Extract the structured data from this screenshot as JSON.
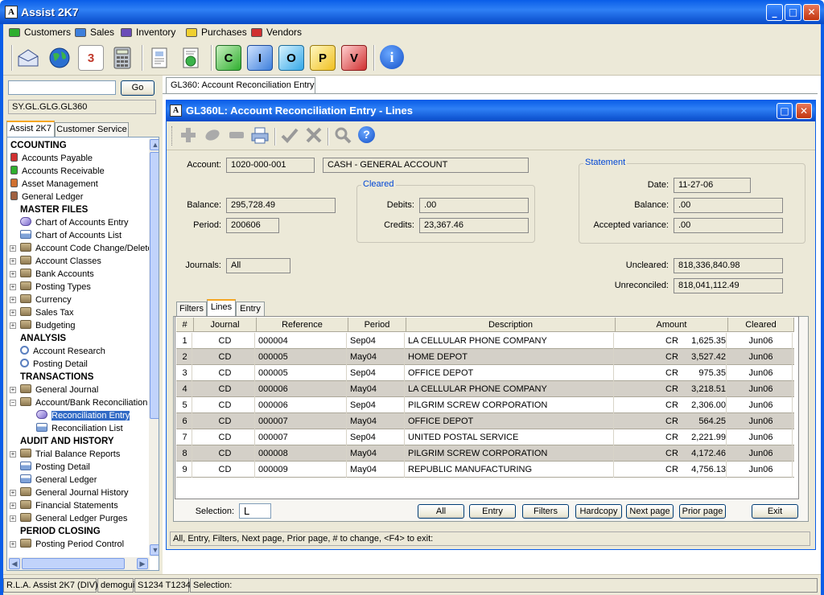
{
  "window": {
    "title": "Assist 2K7",
    "logo_text": "A",
    "minimize": "_",
    "maximize": "□",
    "close": "✕"
  },
  "menu": [
    {
      "label": "Customers",
      "color": "#2eae2e"
    },
    {
      "label": "Sales",
      "color": "#3d7fdc"
    },
    {
      "label": "Inventory",
      "color": "#6a4cb8"
    },
    {
      "label": "Purchases",
      "color": "#f0d030"
    },
    {
      "label": "Vendors",
      "color": "#d03030"
    }
  ],
  "toolbar": {
    "icons": [
      "mail-icon",
      "globe-icon",
      "calendar-icon",
      "calculator-icon",
      "document-icon",
      "chart-icon",
      "customers-c-icon",
      "inventory-i-icon",
      "orders-o-icon",
      "purchases-p-icon",
      "vendors-v-icon",
      "info-icon"
    ],
    "letters": {
      "calendar": "3",
      "c": "C",
      "i": "I",
      "o": "O",
      "p": "P",
      "v": "V",
      "info": "i"
    }
  },
  "left": {
    "search_value": "",
    "go_label": "Go",
    "path": "SY.GL.GLG.GL360",
    "tabs": [
      "Assist 2K7",
      "Customer Service"
    ],
    "tree": [
      {
        "label": "CCOUNTING",
        "type": "header",
        "indent": 0
      },
      {
        "label": "Accounts Payable",
        "type": "book",
        "color": "#d03030",
        "indent": 0
      },
      {
        "label": "Accounts Receivable",
        "type": "book",
        "color": "#2eae2e",
        "indent": 0
      },
      {
        "label": "Asset Management",
        "type": "book",
        "color": "#d07030",
        "indent": 0
      },
      {
        "label": "General Ledger",
        "type": "book",
        "color": "#a06040",
        "indent": 0
      },
      {
        "label": "MASTER FILES",
        "type": "header",
        "indent": 1
      },
      {
        "label": "Chart of Accounts Entry",
        "type": "pen",
        "indent": 1
      },
      {
        "label": "Chart of Accounts List",
        "type": "print",
        "indent": 1
      },
      {
        "label": "Account Code Change/Delete",
        "type": "folder",
        "indent": 1
      },
      {
        "label": "Account Classes",
        "type": "folder",
        "indent": 1
      },
      {
        "label": "Bank Accounts",
        "type": "folder",
        "indent": 1
      },
      {
        "label": "Posting Types",
        "type": "folder",
        "indent": 1
      },
      {
        "label": "Currency",
        "type": "folder",
        "indent": 1
      },
      {
        "label": "Sales Tax",
        "type": "folder",
        "indent": 1
      },
      {
        "label": "Budgeting",
        "type": "folder",
        "indent": 1
      },
      {
        "label": "ANALYSIS",
        "type": "header",
        "indent": 1
      },
      {
        "label": "Account Research",
        "type": "search",
        "indent": 1
      },
      {
        "label": "Posting Detail",
        "type": "search",
        "indent": 1
      },
      {
        "label": "TRANSACTIONS",
        "type": "header",
        "indent": 1
      },
      {
        "label": "General Journal",
        "type": "folder",
        "indent": 1
      },
      {
        "label": "Account/Bank Reconciliation",
        "type": "folder",
        "indent": 1
      },
      {
        "label": "Reconciliation Entry",
        "type": "pen",
        "indent": 2,
        "selected": true
      },
      {
        "label": "Reconciliation List",
        "type": "print",
        "indent": 2
      },
      {
        "label": "AUDIT AND HISTORY",
        "type": "header",
        "indent": 1
      },
      {
        "label": "Trial Balance Reports",
        "type": "folder",
        "indent": 1
      },
      {
        "label": "Posting Detail",
        "type": "print",
        "indent": 1
      },
      {
        "label": "General Ledger",
        "type": "print",
        "indent": 1
      },
      {
        "label": "General Journal History",
        "type": "folder",
        "indent": 1
      },
      {
        "label": "Financial Statements",
        "type": "folder",
        "indent": 1
      },
      {
        "label": "General Ledger Purges",
        "type": "folder",
        "indent": 1
      },
      {
        "label": "PERIOD CLOSING",
        "type": "header",
        "indent": 1
      },
      {
        "label": "Posting Period Control",
        "type": "folder",
        "indent": 1
      }
    ]
  },
  "mdi_tab": "GL360: Account Reconciliation Entry",
  "child": {
    "title": "GL360L: Account Reconciliation Entry - Lines",
    "logo_text": "A",
    "toolbar_icons": [
      "add-icon",
      "edit-icon",
      "delete-icon",
      "print-icon",
      "accept-check-icon",
      "cancel-x-icon",
      "find-icon",
      "help-icon"
    ],
    "fields": {
      "account_label": "Account:",
      "account": "1020-000-001",
      "account_name": "CASH - GENERAL ACCOUNT",
      "balance_label": "Balance:",
      "balance": "295,728.49",
      "period_label": "Period:",
      "period": "200606",
      "journals_label": "Journals:",
      "journals": "All",
      "cleared_group": "Cleared",
      "debits_label": "Debits:",
      "debits": ".00",
      "credits_label": "Credits:",
      "credits": "23,367.46",
      "statement_group": "Statement",
      "date_label": "Date:",
      "date": "11-27-06",
      "stmt_balance_label": "Balance:",
      "stmt_balance": ".00",
      "variance_label": "Accepted variance:",
      "variance": ".00",
      "uncleared_label": "Uncleared:",
      "uncleared": "818,336,840.98",
      "unreconciled_label": "Unreconciled:",
      "unreconciled": "818,041,112.49"
    },
    "subtabs": [
      "Filters",
      "Lines",
      "Entry"
    ],
    "active_subtab": "Lines",
    "table": {
      "columns": [
        "#",
        "Journal",
        "Reference",
        "Period",
        "Description",
        "Amount",
        "Cleared"
      ],
      "rows": [
        {
          "n": "1",
          "journal": "CD",
          "ref": "000004",
          "period": "Sep04",
          "desc": "LA CELLULAR PHONE COMPANY",
          "type": "CR",
          "amount": "1,625.35",
          "cleared": "Jun06"
        },
        {
          "n": "2",
          "journal": "CD",
          "ref": "000005",
          "period": "May04",
          "desc": "HOME DEPOT",
          "type": "CR",
          "amount": "3,527.42",
          "cleared": "Jun06"
        },
        {
          "n": "3",
          "journal": "CD",
          "ref": "000005",
          "period": "Sep04",
          "desc": "OFFICE DEPOT",
          "type": "CR",
          "amount": "975.35",
          "cleared": "Jun06"
        },
        {
          "n": "4",
          "journal": "CD",
          "ref": "000006",
          "period": "May04",
          "desc": "LA CELLULAR PHONE COMPANY",
          "type": "CR",
          "amount": "3,218.51",
          "cleared": "Jun06"
        },
        {
          "n": "5",
          "journal": "CD",
          "ref": "000006",
          "period": "Sep04",
          "desc": "PILGRIM SCREW CORPORATION",
          "type": "CR",
          "amount": "2,306.00",
          "cleared": "Jun06"
        },
        {
          "n": "6",
          "journal": "CD",
          "ref": "000007",
          "period": "May04",
          "desc": "OFFICE DEPOT",
          "type": "CR",
          "amount": "564.25",
          "cleared": "Jun06"
        },
        {
          "n": "7",
          "journal": "CD",
          "ref": "000007",
          "period": "Sep04",
          "desc": "UNITED POSTAL SERVICE",
          "type": "CR",
          "amount": "2,221.99",
          "cleared": "Jun06"
        },
        {
          "n": "8",
          "journal": "CD",
          "ref": "000008",
          "period": "May04",
          "desc": "PILGRIM SCREW CORPORATION",
          "type": "CR",
          "amount": "4,172.46",
          "cleared": "Jun06"
        },
        {
          "n": "9",
          "journal": "CD",
          "ref": "000009",
          "period": "May04",
          "desc": "REPUBLIC MANUFACTURING",
          "type": "CR",
          "amount": "4,756.13",
          "cleared": "Jun06"
        }
      ]
    },
    "selection_label": "Selection:",
    "selection_value": "L",
    "buttons": [
      "All",
      "Entry",
      "Filters",
      "Hardcopy",
      "Next page",
      "Prior page",
      "Exit"
    ],
    "hint": "All,  Entry,  Filters,  Next page,  Prior page,  # to change,  <F4> to exit:"
  },
  "status": {
    "app": "R.L.A. Assist 2K7 (DIV)",
    "user": "demogui",
    "terminal": "S1234 T1234",
    "selection": "Selection:"
  }
}
